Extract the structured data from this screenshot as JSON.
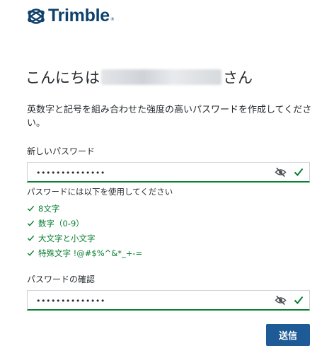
{
  "brand": {
    "name": "Trimble",
    "registered": "®"
  },
  "greeting": {
    "prefix": "こんにちは",
    "suffix": "さん"
  },
  "intro": "英数字と記号を組み合わせた強度の高いパスワードを作成してください。",
  "new_password": {
    "label": "新しいパスワード",
    "value": "••••••••••••••"
  },
  "requirements": {
    "title": "パスワードには以下を使用してください",
    "items": [
      {
        "label": "8文字"
      },
      {
        "label": "数字（0-9）"
      },
      {
        "label": "大文字と小文字"
      },
      {
        "label": "特殊文字 !@#$%^&*_+-="
      }
    ]
  },
  "confirm_password": {
    "label": "パスワードの確認",
    "value": "••••••••••••••"
  },
  "submit": {
    "label": "送信"
  },
  "colors": {
    "brand": "#0e416c",
    "success": "#0a7e32",
    "button": "#1e5a96"
  },
  "icons": {
    "visibility_toggle": "eye-off-icon",
    "valid": "check-icon"
  }
}
